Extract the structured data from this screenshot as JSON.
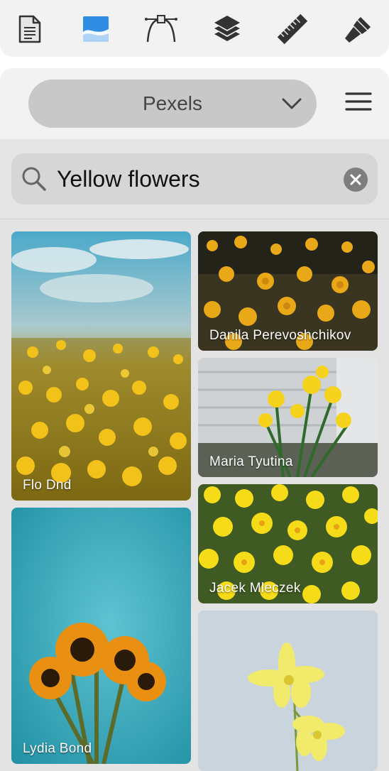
{
  "toolbar": {
    "tools": [
      {
        "icon": "document-icon",
        "active": false
      },
      {
        "icon": "image-icon",
        "active": true
      },
      {
        "icon": "bezier-pen-icon",
        "active": false
      },
      {
        "icon": "layers-icon",
        "active": false
      },
      {
        "icon": "ruler-icon",
        "active": false
      },
      {
        "icon": "paint-brush-icon",
        "active": false
      }
    ],
    "accent_color": "#2f8de4"
  },
  "source": {
    "selected": "Pexels",
    "icon": "chevron-down-icon"
  },
  "menu": {
    "icon": "hamburger-menu-icon"
  },
  "search": {
    "query": "Yellow flowers",
    "icon": "search-icon",
    "clear_icon": "clear-icon"
  },
  "results": [
    {
      "photographer": "Flo Dnd"
    },
    {
      "photographer": "Danila Perevoshchikov"
    },
    {
      "photographer": "Maria Tyutina"
    },
    {
      "photographer": "Jacek Mleczek"
    },
    {
      "photographer": "Lydia Bond"
    },
    {
      "photographer": ""
    }
  ]
}
